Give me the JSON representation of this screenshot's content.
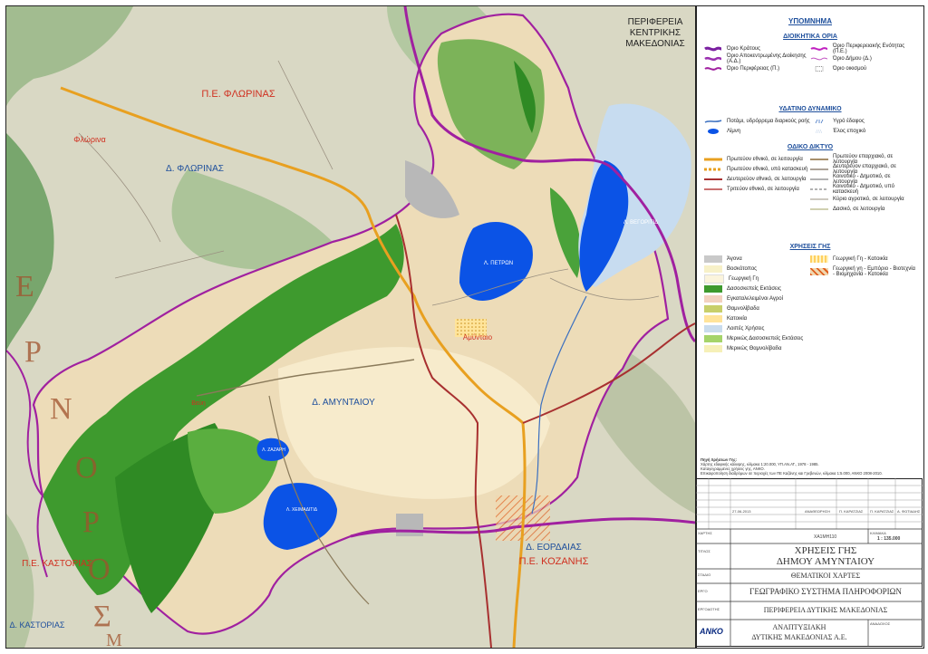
{
  "map": {
    "region_central": [
      "ΠΕΡΙΦΕΡΕΙΑ",
      "ΚΕΝΤΡΙΚΗΣ",
      "ΜΑΚΕΔΟΝΙΑΣ"
    ],
    "unit_florina": "Π.Ε. ΦΛΩΡΙΝΑΣ",
    "municipality_florina": "Δ. ΦΛΩΡΙΝΑΣ",
    "town_florina": "Φλώρινα",
    "municipality_amyntaio": "Δ. ΑΜΥΝΤΑΙΟΥ",
    "town_amyntaio": "Αμύνταιο",
    "lake_vegoritida": "Λ. ΒΕΓΟΡΙΤΙΔ",
    "lake_petron": "Λ. ΠΕΤΡΩΝ",
    "lake_zazari": "Λ. ΖΑΖΑΡΗ",
    "lake_cheimaditida": "Λ. ΧΕΙΜΑΔΙΤΙΔ",
    "municipality_eordaia": "Δ. ΕΟΡΔΑΙΑΣ",
    "unit_kozani": "Π.Ε. ΚΟΖΑΝΗΣ",
    "unit_kastoria": "Π.Ε. ΚΑΣΤΟΡΙΑΣ",
    "municipality_kastoria": "Δ. ΚΑΣΤΟΡΙΑΣ",
    "mountain_vertical": [
      "Ο",
      "Ρ",
      "Ο",
      "Σ"
    ],
    "mountain_left": [
      "Ε",
      "Ρ",
      "Ν",
      "Ο"
    ],
    "mountain_bottom": "Μ",
    "village_vevi": "Βεύη"
  },
  "legend": {
    "title": "ΥΠΟΜΝΗΜΑ",
    "admin": {
      "title": "ΔΙΟΙΚΗΤΙΚΑ ΟΡΙΑ",
      "items_left": [
        "Όριο Κράτους",
        "Όριο Αποκεντρωμένης Διοίκησης (Α.Δ.)",
        "Όριο Περιφέρειας (Π.)"
      ],
      "items_right": [
        "Όριο Περιφερειακής Ενότητας (Π.Ε.)",
        "Όριο Δήμου (Δ.)",
        "Όριο οικισμού"
      ]
    },
    "water": {
      "title": "ΥΔΑΤΙΝΟ ΔΥΝΑΜΙΚΟ",
      "items_left": [
        "Ποτάμι, υδρόρρεμα διαρκούς ροής",
        "Λίμνη"
      ],
      "items_right": [
        "Υγρό έδαφος",
        "Έλος εποχικό"
      ]
    },
    "roads": {
      "title": "ΟΔΙΚΟ ΔΙΚΤΥΟ",
      "items_left": [
        "Πρωτεύον εθνικό, σε λειτουργία",
        "Πρωτεύον εθνικό, υπό κατασκευή",
        "Δευτερεύον εθνικό, σε λειτουργία",
        "Τριτεύον εθνικό, σε λειτουργία"
      ],
      "items_right": [
        "Πρωτεύον επαρχιακό, σε λειτουργία",
        "Δευτερεύον επαρχιακό, σε λειτουργία",
        "Κοινοτικό - Δημοτικό, σε λειτουργία",
        "Κοινοτικό - Δημοτικό, υπό κατασκευή",
        "Κύριο αγροτικό, σε λειτουργία",
        "Δασικό, σε λειτουργία"
      ]
    },
    "landuse": {
      "title": "ΧΡΗΣΕΙΣ ΓΗΣ",
      "items_left": [
        "Άγονα",
        "Βοσκότοπος",
        "Γεωργική Γη",
        "Δασοσκεπείς Εκτάσεις",
        "Εγκαταλελειμένοι Αγροί",
        "Θαμνολίβαδα",
        "Κατοικία",
        "Λοιπές Χρήσεις",
        "Μερικώς Δασοσκεπείς Εκτάσεις",
        "Μερικώς Θαμνολίβαδα"
      ],
      "items_right": [
        "Γεωργική Γη - Κατοικία",
        "Γεωργική γη - Εμπόριο - Βιοτεχνία - Βιομηχανία - Κατοικία"
      ]
    },
    "colors": {
      "agona": "#c9c9c9",
      "voskotopos": "#f7f1c8",
      "georgiki": "#fbf4dc",
      "dasos": "#3e9a2e",
      "egkatalel": "#f3d2c0",
      "thamno": "#c8cf6a",
      "katoikia": "#ffe49a",
      "loipes": "#c9dced",
      "merikos_dasos": "#a5d46a",
      "merikos_thamno": "#f6f0b8"
    }
  },
  "sources": {
    "heading": "Πηγή Χρήσεων Γης:",
    "lines": [
      "Χάρτης εδαφικής κάλυψης, κλίμακα 1:20.000, ΥΠ.ΑΝ.ΑΤ., 1978 - 1985.",
      "Καταγεγραμμένες χρήσεις γης, ΑΝΚΟ.",
      "Επικαιροποίηση διαδρόμων σε περιοχές των ΠΕ Καζάνης και Γρεβενών, κλίμακα 1:5.000, ΑΝΚΟ 2008-2010."
    ]
  },
  "titleblock": {
    "date": "27-06-2013",
    "revision_label": "ΑΝΑΘΕΩΡΗΣΗ",
    "map_no": "ΧΑΡΤΗΣ",
    "map_code": "ΧΑ1ΜΗ110",
    "scale_label": "ΚΛΙΜΑΚΑ",
    "scale": "1 : 135.000",
    "title_label": "ΤΙΤΛΟΣ",
    "title_line1": "ΧΡΗΣΕΙΣ ΓΗΣ",
    "title_line2": "ΔΗΜΟΥ ΑΜΥΝΤΑΙΟΥ",
    "study_label": "ΣΤΑΔΙΟ",
    "study": "ΘΕΜΑΤΙΚΟΙ ΧΑΡΤΕΣ",
    "project_label": "ΕΡΓΟ",
    "project": "ΓΕΩΓΡΑΦΙΚΟ ΣΥΣΤΗΜΑ ΠΛΗΡΟΦΟΡΙΩΝ",
    "owner_label": "ΕΡΓΟΔΟΤΗΣ",
    "owner": "ΠΕΡΙΦΕΡΕΙΑ ΔΥΤΙΚΗΣ ΜΑΚΕΔΟΝΙΑΣ",
    "contractor_label": "ΑΝΑΔΟΧΟΣ",
    "contractor_line1": "ΑΝΑΠΤΥΞΙΑΚΗ",
    "contractor_line2": "ΔΥΤΙΚΗΣ ΜΑΚΕΔΟΝΙΑΣ  Α.Ε.",
    "logo": "ΑΝΚΟ",
    "designed_by": "Π. ΚΑΡΑΤΖΙΑΣ",
    "drawn_by": "Π. ΚΑΡΑΤΖΙΑΣ",
    "checked_by": "Α. ΦΩΤΙΑΔΗΣ"
  }
}
